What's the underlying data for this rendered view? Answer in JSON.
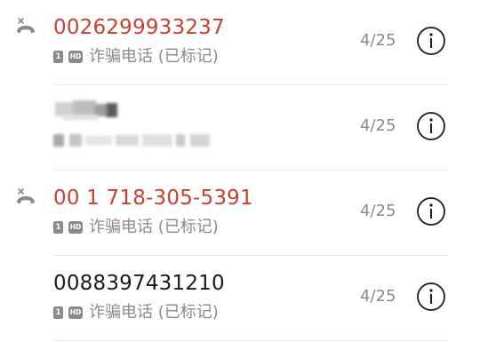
{
  "calls": [
    {
      "number": "0026299933237",
      "missed": true,
      "sim": "1",
      "hd": "HD",
      "label": "诈骗电话 (已标记)",
      "date": "4/25",
      "icon": "missed-call-icon"
    },
    {
      "number": "",
      "missed": false,
      "blurred": true,
      "date": "4/25"
    },
    {
      "number": "00 1 718-305-5391",
      "missed": true,
      "sim": "1",
      "hd": "HD",
      "label": "诈骗电话 (已标记)",
      "date": "4/25",
      "icon": "missed-call-icon"
    },
    {
      "number": "0088397431210",
      "missed": false,
      "sim": "1",
      "hd": "HD",
      "label": "诈骗电话 (已标记)",
      "date": "4/25"
    }
  ],
  "colors": {
    "missed": "#c9402f",
    "normal": "#1a1a1a",
    "secondary": "#8a8a8a",
    "divider": "#e6e6e6"
  },
  "icons": {
    "missed": "missed-call-icon",
    "info": "info-icon",
    "sim": "sim-1-icon",
    "hd": "hd-icon"
  }
}
